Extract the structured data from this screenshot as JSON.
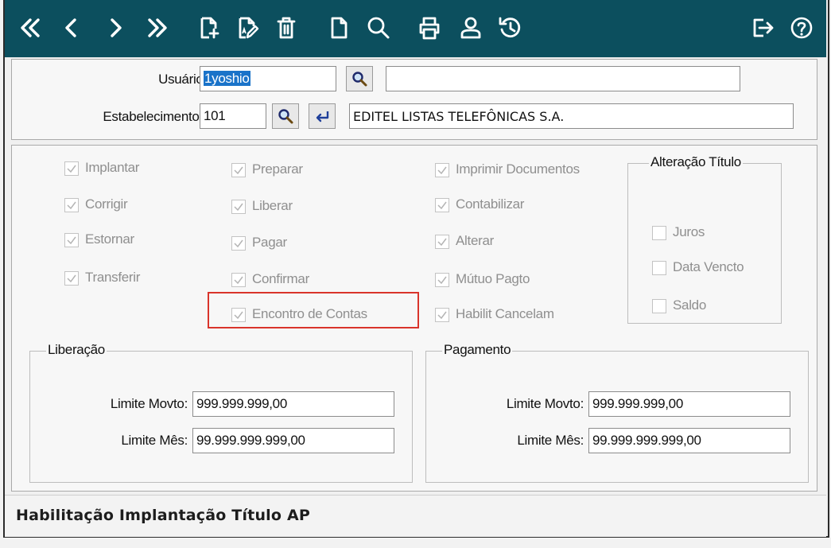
{
  "toolbar": {
    "icons": [
      "first-record-icon",
      "previous-record-icon",
      "next-record-icon",
      "last-record-icon",
      "new-record-icon",
      "edit-record-icon",
      "delete-icon",
      "blank-document-icon",
      "search-icon",
      "print-icon",
      "user-icon",
      "history-icon",
      "exit-icon",
      "help-icon"
    ],
    "color": "#0c4f5e"
  },
  "header": {
    "usuario_label": "Usuário:",
    "usuario_value": "1yoshio",
    "usuario_name": "",
    "estabelecimento_label": "Estabelecimento:",
    "estabelecimento_value": "101",
    "estabelecimento_name": "EDITEL LISTAS TELEFÔNICAS S.A."
  },
  "permissions": {
    "col1": [
      "Implantar",
      "Corrigir",
      "Estornar",
      "Transferir"
    ],
    "col2": [
      "Preparar",
      "Liberar",
      "Pagar",
      "Confirmar",
      "Encontro de Contas"
    ],
    "col3": [
      "Imprimir Documentos",
      "Contabilizar",
      "Alterar",
      "Mútuo Pagto",
      "Habilit Cancelam"
    ]
  },
  "alteracao": {
    "title": "Alteração Título",
    "items": [
      "Juros",
      "Data Vencto",
      "Saldo"
    ]
  },
  "liberacao": {
    "title": "Liberação",
    "limite_movto_label": "Limite Movto:",
    "limite_movto_value": "999.999.999,00",
    "limite_mes_label": "Limite Mês:",
    "limite_mes_value": "99.999.999.999,00"
  },
  "pagamento": {
    "title": "Pagamento",
    "limite_movto_label": "Limite Movto:",
    "limite_movto_value": "999.999.999,00",
    "limite_mes_label": "Limite Mês:",
    "limite_mes_value": "99.999.999.999,00"
  },
  "status": {
    "text": "Habilitação Implantação Título AP"
  },
  "colors": {
    "highlight": "#d9342b",
    "selection": "#1a73c9"
  }
}
